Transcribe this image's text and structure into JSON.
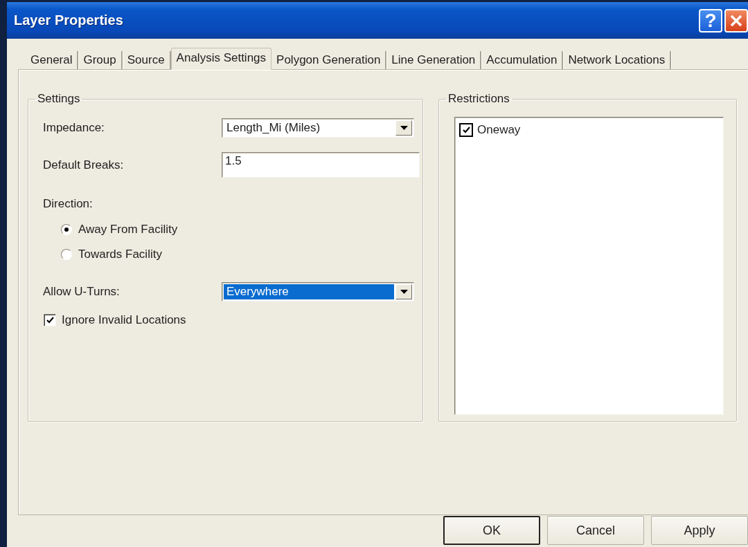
{
  "window": {
    "title": "Layer Properties",
    "help_label": "?"
  },
  "tabs": [
    {
      "label": "General",
      "selected": false
    },
    {
      "label": "Group",
      "selected": false
    },
    {
      "label": "Source",
      "selected": false
    },
    {
      "label": "Analysis Settings",
      "selected": true
    },
    {
      "label": "Polygon Generation",
      "selected": false
    },
    {
      "label": "Line Generation",
      "selected": false
    },
    {
      "label": "Accumulation",
      "selected": false
    },
    {
      "label": "Network Locations",
      "selected": false
    }
  ],
  "settings": {
    "title": "Settings",
    "impedance": {
      "label": "Impedance:",
      "value": "Length_Mi (Miles)",
      "focused": false
    },
    "default_breaks": {
      "label": "Default Breaks:",
      "value": "1.5"
    },
    "direction": {
      "label": "Direction:",
      "options": [
        {
          "label": "Away From Facility",
          "selected": true
        },
        {
          "label": "Towards Facility",
          "selected": false
        }
      ]
    },
    "allow_u_turns": {
      "label": "Allow U-Turns:",
      "value": "Everywhere",
      "focused": true
    },
    "ignore_invalid_locations": {
      "label": "Ignore Invalid Locations",
      "checked": true
    }
  },
  "restrictions": {
    "title": "Restrictions",
    "items": [
      {
        "label": "Oneway",
        "checked": true
      }
    ]
  },
  "buttons": [
    {
      "label": "OK",
      "default": true
    },
    {
      "label": "Cancel",
      "default": false
    },
    {
      "label": "Apply",
      "default": false
    }
  ]
}
